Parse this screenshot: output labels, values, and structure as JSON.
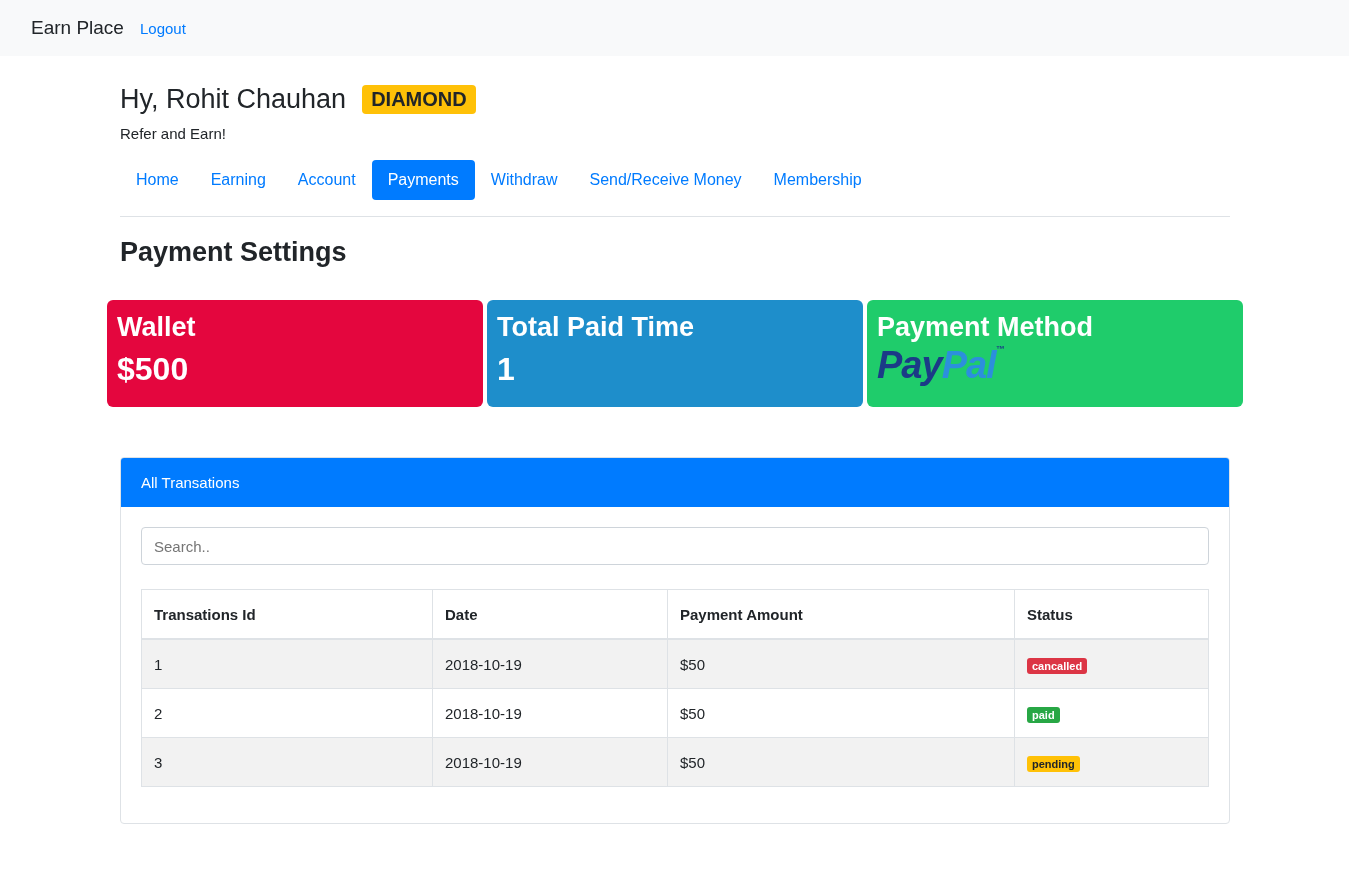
{
  "navbar": {
    "brand": "Earn Place",
    "links": [
      {
        "label": "Logout"
      }
    ]
  },
  "greeting": {
    "title": "Hy, Rohit Chauhan",
    "badge": "DIAMOND",
    "subtitle": "Refer and Earn!"
  },
  "tabs": [
    {
      "label": "Home",
      "selected": false
    },
    {
      "label": "Earning",
      "selected": false
    },
    {
      "label": "Account",
      "selected": false
    },
    {
      "label": "Payments",
      "selected": true
    },
    {
      "label": "Withdraw",
      "selected": false
    },
    {
      "label": "Send/Receive Money",
      "selected": false
    },
    {
      "label": "Membership",
      "selected": false
    }
  ],
  "section_title": "Payment Settings",
  "cards": [
    {
      "kind": "text",
      "title": "Wallet",
      "value": "$500",
      "color": "#e4063e"
    },
    {
      "kind": "text",
      "title": "Total Paid Time",
      "value": "1",
      "color": "#1e8ecb"
    },
    {
      "kind": "logo",
      "title": "Payment Method",
      "logo": {
        "first": "Pay",
        "second": "Pal",
        "mark": "™"
      },
      "color": "#1fcc6b"
    }
  ],
  "transactions": {
    "header": "All Transations",
    "search": {
      "placeholder": "Search.."
    },
    "columns": [
      "Transations Id",
      "Date",
      "Payment Amount",
      "Status"
    ],
    "rows": [
      {
        "id": "1",
        "date": "2018-10-19",
        "amount": "$50",
        "status": {
          "label": "cancalled",
          "kind": "danger"
        }
      },
      {
        "id": "2",
        "date": "2018-10-19",
        "amount": "$50",
        "status": {
          "label": "paid",
          "kind": "success"
        }
      },
      {
        "id": "3",
        "date": "2018-10-19",
        "amount": "$50",
        "status": {
          "label": "pending",
          "kind": "warning"
        }
      }
    ]
  }
}
